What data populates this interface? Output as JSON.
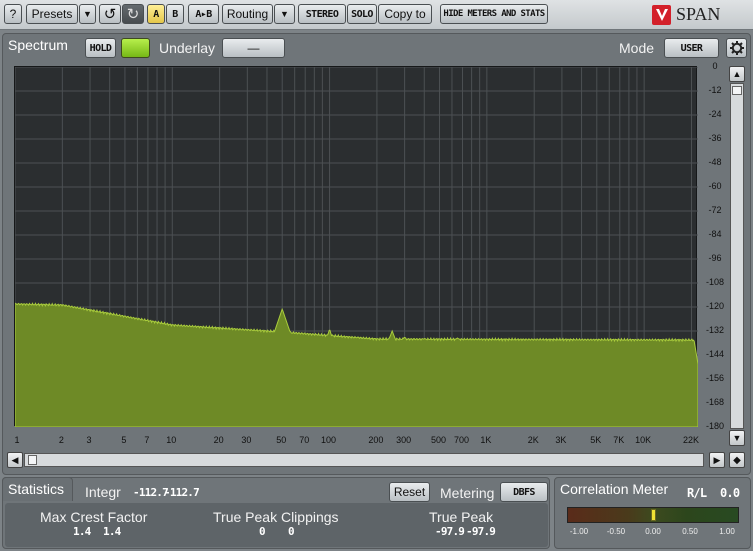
{
  "toolbar": {
    "help_label": "?",
    "presets_label": "Presets",
    "presets_arrow": "▼",
    "undo_icon": "↺",
    "redo_icon": "↻",
    "a_label": "A",
    "b_label": "B",
    "ab_label": "A▸B",
    "routing_label": "Routing",
    "routing_arrow": "▼",
    "stereo_label": "STEREO",
    "solo_label": "SOLO",
    "copyto_label": "Copy to",
    "hide_meters_label": "HIDE METERS AND STATS",
    "brand_name": "SPAN"
  },
  "spectrum": {
    "title": "Spectrum",
    "hold_label": "HOLD",
    "underlay_label": "Underlay",
    "underlay_value": "—",
    "mode_label": "Mode",
    "mode_value": "USER",
    "y_ticks": [
      "0",
      "-12",
      "-24",
      "-36",
      "-48",
      "-60",
      "-72",
      "-84",
      "-96",
      "-108",
      "-120",
      "-132",
      "-144",
      "-156",
      "-168",
      "-180"
    ],
    "x_ticks": [
      "1",
      "2",
      "3",
      "5",
      "7",
      "10",
      "20",
      "30",
      "50",
      "70",
      "100",
      "200",
      "300",
      "500",
      "700",
      "1K",
      "2K",
      "3K",
      "5K",
      "7K",
      "10K",
      "22K"
    ]
  },
  "statistics": {
    "title": "Statistics",
    "integr_label": "Integr",
    "integr_left": "-112.7",
    "integr_right": "-112.7",
    "reset_label": "Reset",
    "metering_label": "Metering",
    "metering_value": "DBFS",
    "max_crest_label": "Max Crest Factor",
    "max_crest_left": "1.4",
    "max_crest_right": "1.4",
    "clippings_label": "True Peak Clippings",
    "clippings_left": "0",
    "clippings_right": "0",
    "true_peak_label": "True Peak",
    "true_peak_left": "-97.9",
    "true_peak_right": "-97.9"
  },
  "correlation": {
    "title": "Correlation Meter",
    "channel_label": "R/L",
    "value": "0.0",
    "ticks": [
      "-1.00",
      "-0.50",
      "0.00",
      "0.50",
      "1.00"
    ]
  },
  "colors": {
    "spectrum_fill": "#6e8a26",
    "spectrum_line": "#a9cc3c",
    "hold_led": "#8fd11e",
    "brand_red": "#d3202a"
  }
}
